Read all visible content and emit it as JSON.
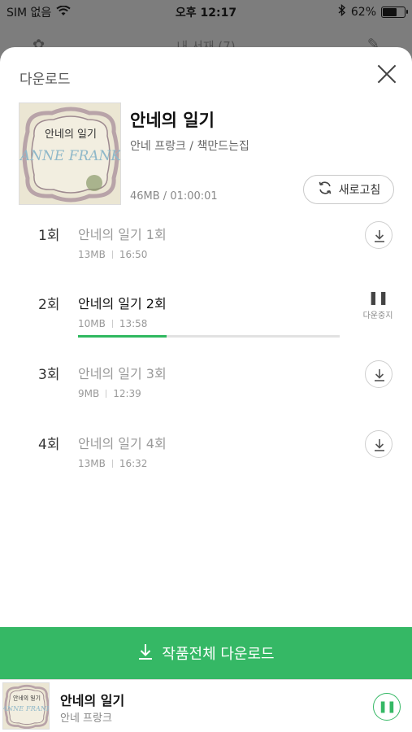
{
  "status_bar": {
    "carrier": "SIM 없음",
    "time": "오후 12:17",
    "battery": "62%",
    "battery_level": 0.62
  },
  "background_header": {
    "title": "내 서재 (7)"
  },
  "sheet": {
    "title": "다운로드",
    "close_icon": "close-icon"
  },
  "album": {
    "title": "안네의 일기",
    "author": "안네 프랑크 / 책만드는집",
    "meta": "46MB / 01:00:01",
    "cover_text_line1": "안네의 일기",
    "cover_text_line2": "ANNE FRANK",
    "refresh_label": "새로고침"
  },
  "episodes": [
    {
      "number": "1회",
      "title": "안네의 일기 1회",
      "size": "13MB",
      "duration": "16:50",
      "state": "download"
    },
    {
      "number": "2회",
      "title": "안네의 일기 2회",
      "size": "10MB",
      "duration": "13:58",
      "state": "downloading",
      "progress": 0.34,
      "action_label": "다운중지"
    },
    {
      "number": "3회",
      "title": "안네의 일기 3회",
      "size": "9MB",
      "duration": "12:39",
      "state": "download"
    },
    {
      "number": "4회",
      "title": "안네의 일기 4회",
      "size": "13MB",
      "duration": "16:32",
      "state": "download"
    }
  ],
  "download_all": {
    "label": "작품전체 다운로드"
  },
  "player": {
    "title": "안네의 일기",
    "author": "안네 프랑크"
  },
  "colors": {
    "accent": "#35b865"
  }
}
